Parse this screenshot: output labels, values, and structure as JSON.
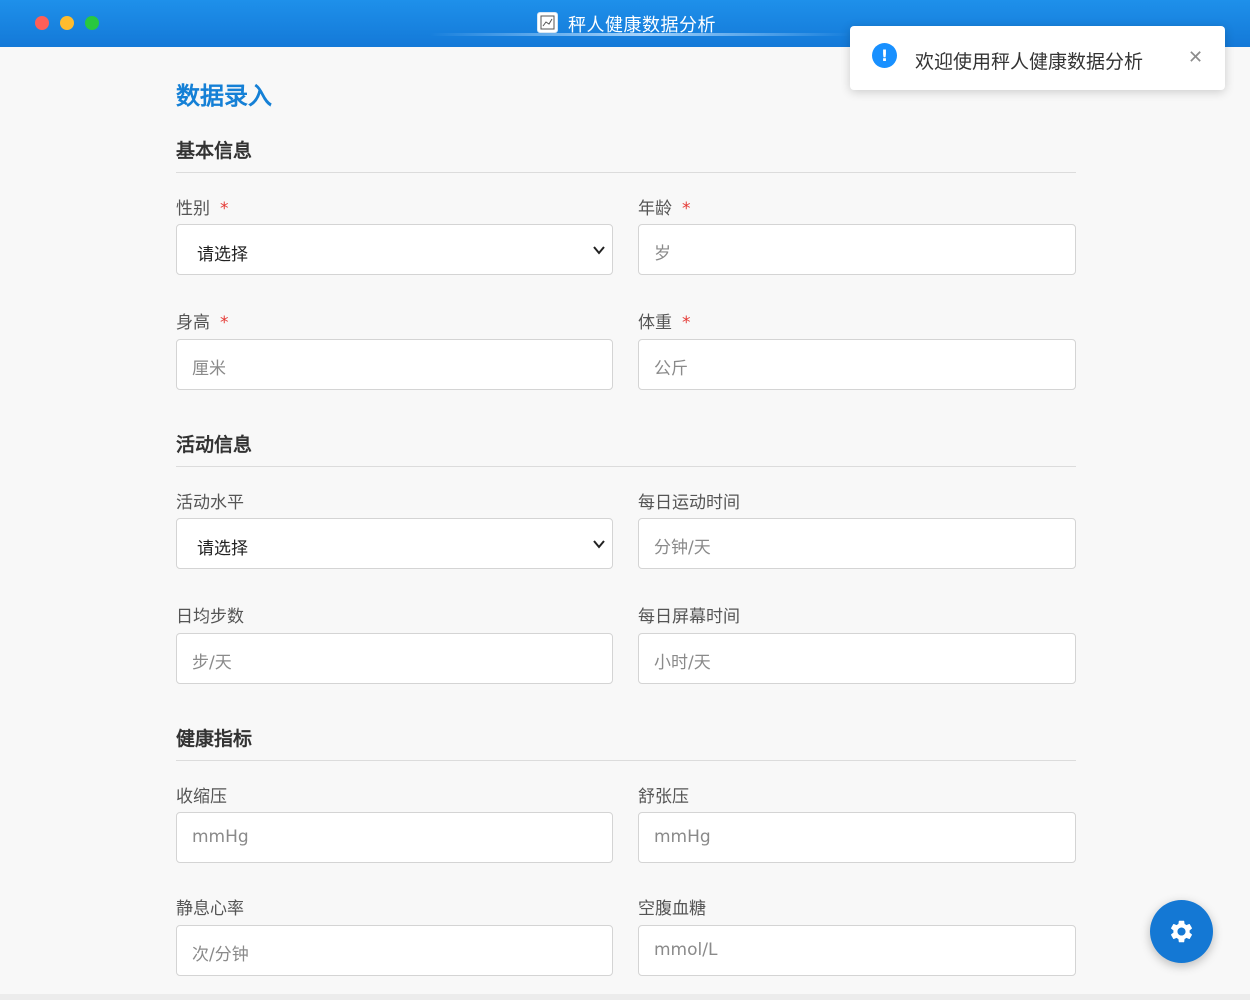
{
  "window": {
    "title": "秤人健康数据分析"
  },
  "page": {
    "title": "数据录入"
  },
  "sections": {
    "basic": {
      "title": "基本信息",
      "gender": {
        "label": "性别",
        "required": "*",
        "value": "请选择"
      },
      "age": {
        "label": "年龄",
        "required": "*",
        "placeholder": "岁"
      },
      "height": {
        "label": "身高",
        "required": "*",
        "placeholder": "厘米"
      },
      "weight": {
        "label": "体重",
        "required": "*",
        "placeholder": "公斤"
      }
    },
    "activity": {
      "title": "活动信息",
      "level": {
        "label": "活动水平",
        "value": "请选择"
      },
      "exercise": {
        "label": "每日运动时间",
        "placeholder": "分钟/天"
      },
      "steps": {
        "label": "日均步数",
        "placeholder": "步/天"
      },
      "screen": {
        "label": "每日屏幕时间",
        "placeholder": "小时/天"
      }
    },
    "health": {
      "title": "健康指标",
      "systolic": {
        "label": "收缩压",
        "placeholder": "mmHg"
      },
      "diastolic": {
        "label": "舒张压",
        "placeholder": "mmHg"
      },
      "heart_rate": {
        "label": "静息心率",
        "placeholder": "次/分钟"
      },
      "glucose": {
        "label": "空腹血糖",
        "placeholder": "mmol/L"
      }
    }
  },
  "toast": {
    "message": "欢迎使用秤人健康数据分析",
    "icon": "!",
    "close": "✕"
  },
  "colors": {
    "accent": "#1580d6",
    "titlebar": "#1479d8",
    "required": "#e53935",
    "toast_icon": "#1890ff"
  },
  "icons": {
    "fab": "gear-icon",
    "select": "chevron-down-icon",
    "toast": "info-icon"
  }
}
